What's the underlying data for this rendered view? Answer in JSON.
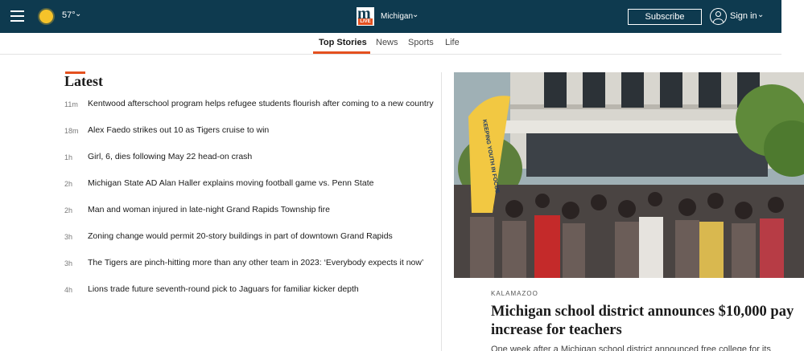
{
  "header": {
    "weather": {
      "icon": "sun-icon",
      "temperature": "57°"
    },
    "logo": {
      "mark": "m",
      "badge": "LIVE"
    },
    "edition": "Michigan",
    "subscribe_label": "Subscribe",
    "signin_label": "Sign in",
    "colors": {
      "bar": "#0e3a4f",
      "accent": "#e4501f"
    }
  },
  "tabs": [
    {
      "label": "Top Stories",
      "active": true
    },
    {
      "label": "News",
      "active": false
    },
    {
      "label": "Sports",
      "active": false
    },
    {
      "label": "Life",
      "active": false
    }
  ],
  "latest": {
    "title": "Latest",
    "items": [
      {
        "time": "11m",
        "headline": "Kentwood afterschool program helps refugee students flourish after coming to a new country"
      },
      {
        "time": "18m",
        "headline": "Alex Faedo strikes out 10 as Tigers cruise to win"
      },
      {
        "time": "1h",
        "headline": "Girl, 6, dies following May 22 head-on crash"
      },
      {
        "time": "2h",
        "headline": "Michigan State AD Alan Haller explains moving football game vs. Penn State"
      },
      {
        "time": "2h",
        "headline": "Man and woman injured in late-night Grand Rapids Township fire"
      },
      {
        "time": "3h",
        "headline": "Zoning change would permit 20-story buildings in part of downtown Grand Rapids"
      },
      {
        "time": "3h",
        "headline": "The Tigers are pinch-hitting more than any other team in 2023: ‘Everybody expects it now’"
      },
      {
        "time": "4h",
        "headline": "Lions trade future seventh-round pick to Jaguars for familiar kicker depth"
      }
    ]
  },
  "feature": {
    "kicker": "KALAMAZOO",
    "headline": "Michigan school district announces $10,000 pay increase for teachers",
    "dek": "One week after a Michigan school district announced free college for its",
    "banner_text": "KEEPING YOUTH IN FOCUS"
  }
}
